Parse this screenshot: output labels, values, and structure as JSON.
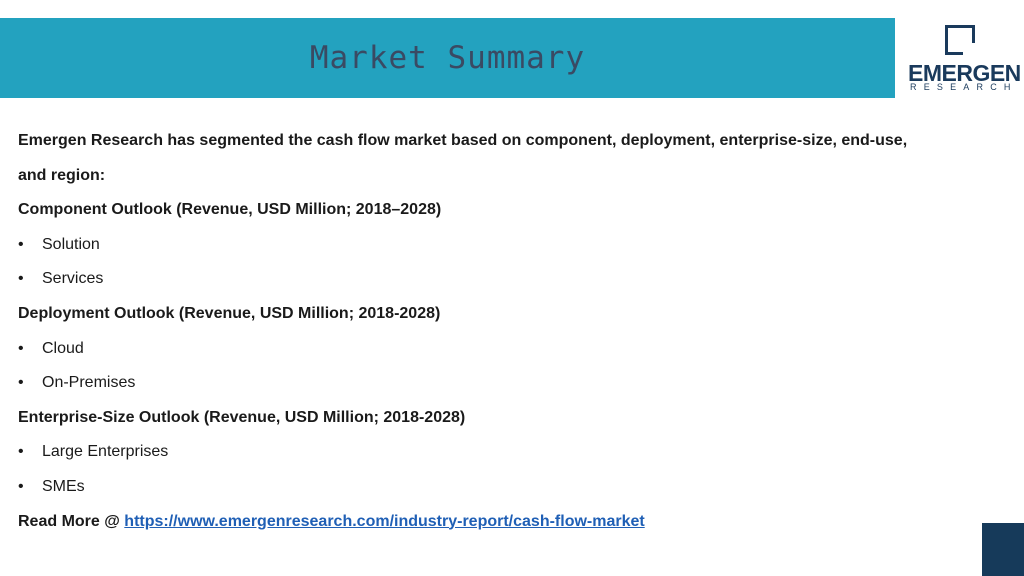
{
  "header": {
    "title": "Market Summary"
  },
  "logo": {
    "name": "EMERGEN",
    "sub": "RESEARCH"
  },
  "content": {
    "intro_line1": "Emergen Research has segmented the cash flow market based on component, deployment, enterprise-size, end-use,",
    "intro_line2": "and region:",
    "sections": [
      {
        "heading": "Component Outlook (Revenue, USD Million; 2018–2028)",
        "items": [
          "Solution",
          "Services"
        ]
      },
      {
        "heading": "Deployment Outlook (Revenue, USD Million; 2018-2028)",
        "items": [
          "Cloud",
          "On-Premises"
        ]
      },
      {
        "heading": "Enterprise-Size Outlook (Revenue, USD Million; 2018-2028)",
        "items": [
          "Large Enterprises",
          "SMEs"
        ]
      }
    ],
    "read_more_label": "Read More @ ",
    "read_more_url": "https://www.emergenresearch.com/industry-report/cash-flow-market",
    "bullet_symbol": "•"
  },
  "colors": {
    "header_band": "#23a2bf",
    "title_text": "#3a4a63",
    "brand_navy": "#1a3a5c",
    "link": "#1f5fb5"
  }
}
